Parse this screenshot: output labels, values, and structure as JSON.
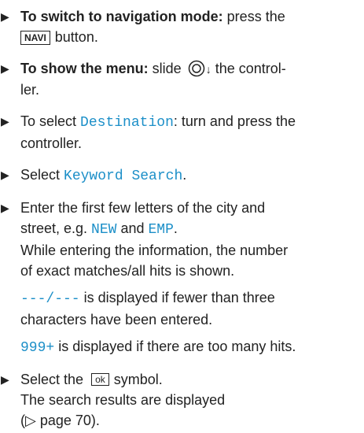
{
  "items": {
    "i1": {
      "bold": "To switch to navigation mode:",
      "text1": " press the",
      "button": "NAVI",
      "text2": "button."
    },
    "i2": {
      "bold": "To show the menu:",
      "text1": " slide",
      "text2": " the control-",
      "text3": "ler."
    },
    "i3": {
      "text1": "To select ",
      "mono": "Destination",
      "text2": ": turn and press the",
      "text3": "controller."
    },
    "i4": {
      "text1": "Select ",
      "mono": "Keyword Search",
      "text2": "."
    },
    "i5": {
      "line1": "Enter the first few letters of the city and",
      "text1": "street, e.g. ",
      "mono1": "NEW",
      "text2": " and ",
      "mono2": "EMP",
      "text3": ".",
      "line3": "While entering the information, the number",
      "line4": "of exact matches/all hits is shown."
    },
    "note1": {
      "mono": "---/---",
      "text1": " is displayed if fewer than three",
      "text2": "characters have been entered."
    },
    "note2": {
      "mono": "999+",
      "text": " is displayed if there are too many hits."
    },
    "i6": {
      "text1": "Select the",
      "symbol": "ok",
      "text2": "symbol.",
      "line2": "The search results are displayed",
      "line3": "(▷ page 70)."
    }
  }
}
